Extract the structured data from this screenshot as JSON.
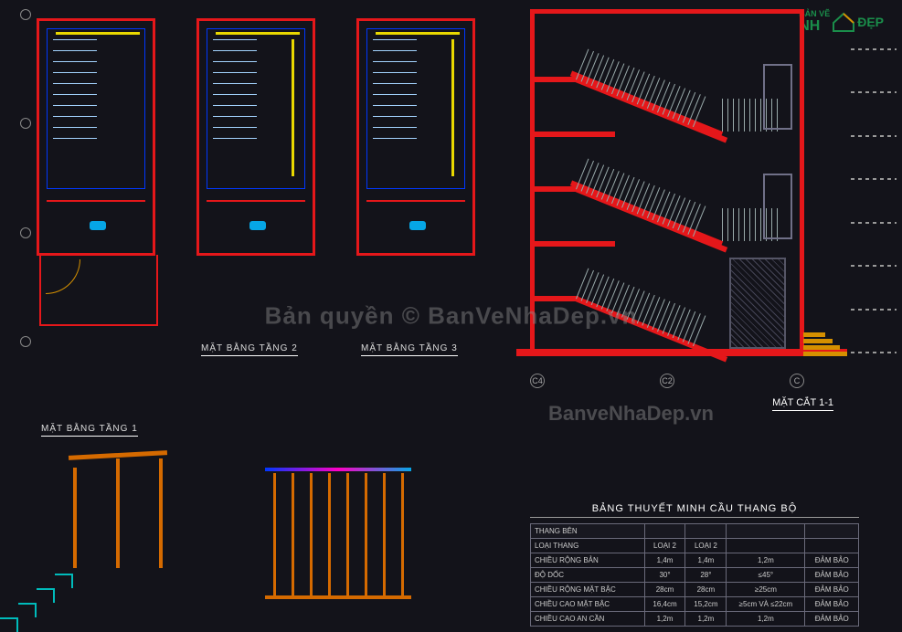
{
  "logo": {
    "left": "BẢN VẼ",
    "brand_left": "NH",
    "brand_right": "ĐẸP"
  },
  "plans": {
    "p1": "MẶT BẰNG TẦNG 1",
    "p2": "MẶT BẰNG TẦNG 2",
    "p3": "MẶT BẰNG TẦNG 3"
  },
  "section": {
    "caption": "MẶT CẮT 1-1",
    "grid": [
      "C4",
      "C2",
      "C"
    ]
  },
  "watermarks": {
    "center": "Bản quyền © BanVeNhaDep.vn",
    "url": "BanveNhaDep.vn"
  },
  "table": {
    "title": "BẢNG THUYẾT MINH CẦU THANG BỘ",
    "header": [
      "THANG BÊN",
      "",
      "",
      "",
      ""
    ],
    "rows": [
      {
        "label": "LOẠI THANG",
        "c1": "LOẠI 2",
        "c2": "LOẠI 2",
        "c3": "",
        "c4": ""
      },
      {
        "label": "CHIỀU RỘNG BẢN",
        "c1": "1,4m",
        "c2": "1,4m",
        "c3": "1,2m",
        "c4": "ĐẢM BẢO"
      },
      {
        "label": "ĐỘ DỐC",
        "c1": "30°",
        "c2": "28°",
        "c3": "≤45°",
        "c4": "ĐẢM BẢO"
      },
      {
        "label": "CHIỀU RỘNG MẶT BẬC",
        "c1": "28cm",
        "c2": "28cm",
        "c3": "≥25cm",
        "c4": "ĐẢM BẢO"
      },
      {
        "label": "CHIỀU CAO MẶT BẬC",
        "c1": "16,4cm",
        "c2": "15,2cm",
        "c3": "≥5cm VÀ ≤22cm",
        "c4": "ĐẢM BẢO"
      },
      {
        "label": "CHIỀU CAO AN CẦN",
        "c1": "1,2m",
        "c2": "1,2m",
        "c3": "1,2m",
        "c4": "ĐẢM BẢO"
      }
    ]
  }
}
